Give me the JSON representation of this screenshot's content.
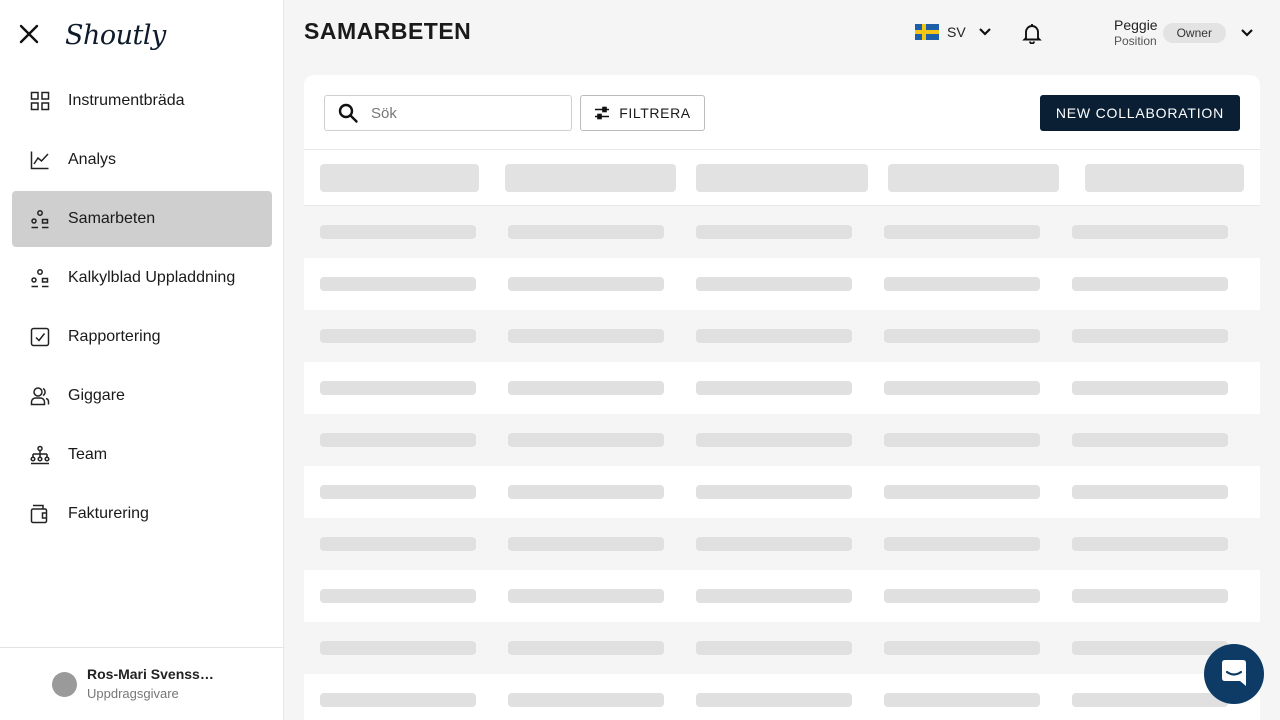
{
  "sidebar": {
    "logo": "Shoutly",
    "items": [
      {
        "label": "Instrumentbräda",
        "icon": "dashboard-grid-icon",
        "active": false
      },
      {
        "label": "Analys",
        "icon": "line-chart-icon",
        "active": false
      },
      {
        "label": "Samarbeten",
        "icon": "collaboration-icon",
        "active": true
      },
      {
        "label": "Kalkylblad Uppladdning",
        "icon": "spreadsheet-upload-icon",
        "active": false
      },
      {
        "label": "Rapportering",
        "icon": "checkbox-report-icon",
        "active": false
      },
      {
        "label": "Giggare",
        "icon": "people-icon",
        "active": false
      },
      {
        "label": "Team",
        "icon": "team-hierarchy-icon",
        "active": false
      },
      {
        "label": "Fakturering",
        "icon": "invoice-wallet-icon",
        "active": false
      }
    ],
    "user": {
      "name": "Ros-Mari Svensso…",
      "role": "Uppdragsgivare"
    }
  },
  "header": {
    "title": "SAMARBETEN",
    "language": {
      "code": "SV",
      "flag": "swedish-flag-icon"
    },
    "profile": {
      "name": "Peggie",
      "position": "Position",
      "badge": "Owner"
    }
  },
  "toolbar": {
    "search_placeholder": "Sök",
    "search_value": "",
    "filter_label": "FILTRERA",
    "new_button": "NEW COLLABORATION"
  },
  "table": {
    "state": "loading",
    "column_count": 5,
    "row_count": 10
  },
  "colors": {
    "primary": "#0a1f33",
    "active_nav": "#cfcfcf",
    "skeleton": "#e0e0e0",
    "chat": "#0d3b66"
  }
}
